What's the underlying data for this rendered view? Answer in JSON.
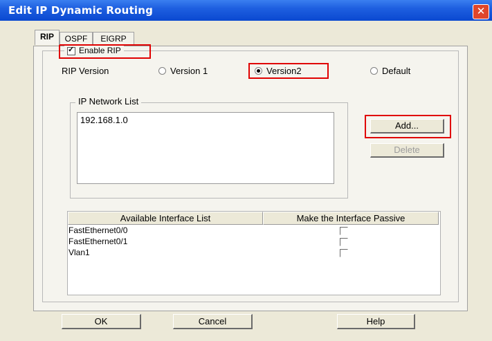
{
  "window": {
    "title": "Edit IP Dynamic Routing",
    "close_label": "✕"
  },
  "tabs": [
    "RIP",
    "OSPF",
    "EIGRP"
  ],
  "rip": {
    "enable_label": "Enable RIP",
    "enable_checked": true,
    "version_label": "RIP Version",
    "versions": [
      {
        "label": "Version 1",
        "selected": false
      },
      {
        "label": "Version2",
        "selected": true
      },
      {
        "label": "Default",
        "selected": false
      }
    ]
  },
  "network_list": {
    "title": "IP Network List",
    "items": [
      "192.168.1.0"
    ],
    "add_label": "Add...",
    "delete_label": "Delete"
  },
  "interfaces": {
    "col_available": "Available Interface List",
    "col_passive": "Make the Interface Passive",
    "rows": [
      {
        "name": "FastEthernet0/0",
        "passive": false
      },
      {
        "name": "FastEthernet0/1",
        "passive": false
      },
      {
        "name": "Vlan1",
        "passive": false
      }
    ]
  },
  "footer": {
    "ok_label": "OK",
    "cancel_label": "Cancel",
    "help_label": "Help"
  },
  "highlight_color": "#e00000"
}
